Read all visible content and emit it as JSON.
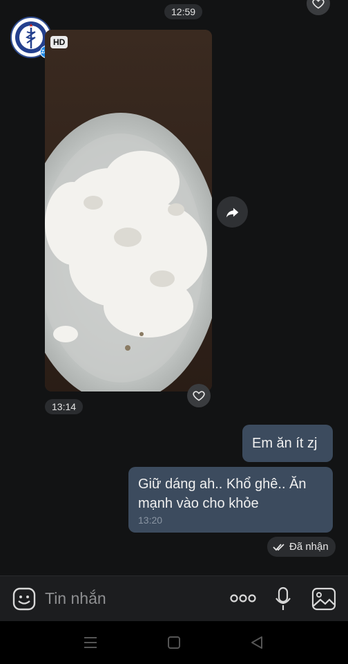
{
  "messages": {
    "top_time": "12:59",
    "photo_time": "13:14",
    "hd_label": "HD",
    "sent_1": "Em ăn ít zj",
    "sent_2": "Giữ dáng ah.. Khổ ghê.. Ăn mạnh vào cho khỏe",
    "sent_2_time": "13:20",
    "status": "Đã nhận"
  },
  "avatar": {
    "badge": "Zalo"
  },
  "input": {
    "placeholder": "Tin nhắn"
  },
  "colors": {
    "sent_bubble": "#3c4b5e",
    "background": "#121314",
    "pill": "#2a2c2f"
  },
  "icons": [
    "heart-icon",
    "forward-icon",
    "sticker-icon",
    "more-icon",
    "microphone-icon",
    "image-icon",
    "recent-apps-icon",
    "home-icon",
    "back-icon",
    "double-check-icon"
  ]
}
